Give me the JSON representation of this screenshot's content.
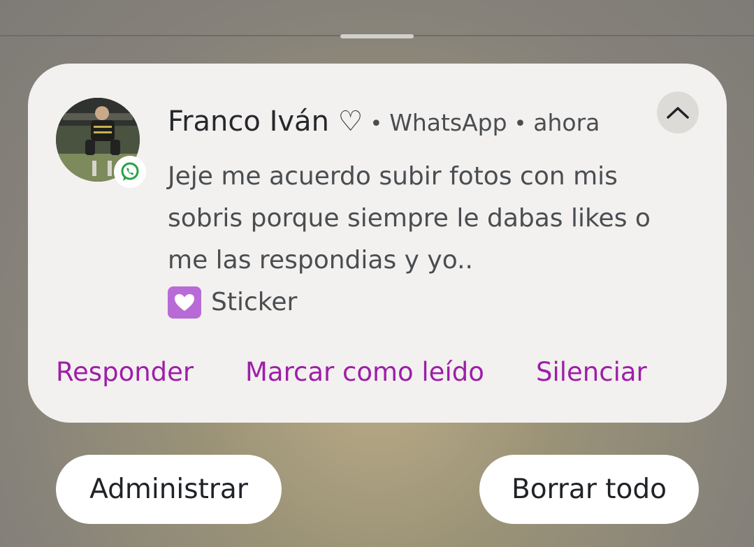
{
  "notification": {
    "sender": "Franco Iván ♡",
    "separator": "•",
    "app_name": "WhatsApp",
    "time": "ahora",
    "message_lines": [
      "Jeje me acuerdo subir fotos con mis",
      "sobris porque siempre le dabas likes o",
      "me las respondias y yo.."
    ],
    "sticker_label": "Sticker",
    "avatar": "contact-photo",
    "app_icon": "whatsapp-icon",
    "collapse_icon": "chevron-up-icon",
    "actions": {
      "reply": "Responder",
      "mark_read": "Marcar como leído",
      "mute": "Silenciar"
    }
  },
  "footer": {
    "manage_label": "Administrar",
    "clear_all_label": "Borrar todo"
  },
  "colors": {
    "card_background": "#f2f1ef",
    "action_text": "#9e1ea8",
    "whatsapp_green": "#25a244",
    "pill_background": "#ffffff"
  }
}
